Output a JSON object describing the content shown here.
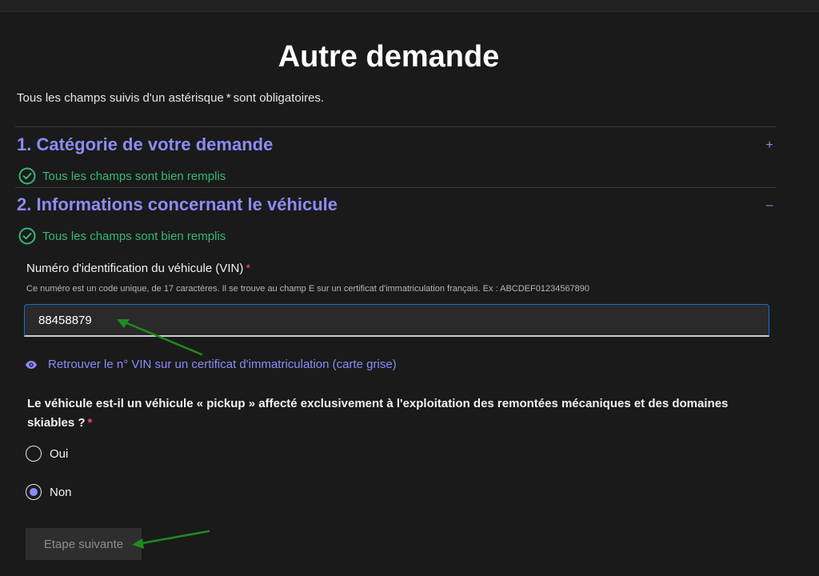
{
  "page": {
    "title": "Autre demande",
    "required_note_pre": "Tous les champs suivis d'un astérisque",
    "required_note_mark": "*",
    "required_note_post": "sont obligatoires."
  },
  "sections": [
    {
      "title": "1. Catégorie de votre demande",
      "toggle": "+",
      "status": "Tous les champs sont bien remplis"
    },
    {
      "title": "2. Informations concernant le véhicule",
      "toggle": "–",
      "status": "Tous les champs sont bien remplis"
    }
  ],
  "vin_field": {
    "label": "Numéro d'identification du véhicule (VIN)",
    "required_mark": "*",
    "hint": "Ce numéro est un code unique, de 17 caractères. Il se trouve au champ E sur un certificat d'immatriculation français. Ex : ABCDEF01234567890",
    "value": "88458879"
  },
  "vin_help_link": {
    "icon": "eye-icon",
    "label": "Retrouver le n° VIN sur un certificat d'immatriculation (carte grise)"
  },
  "pickup_question": {
    "label": "Le véhicule est-il un véhicule « pickup » affecté exclusivement à l'exploitation des remontées mécaniques et des domaines skiables ?",
    "required_mark": "*",
    "options": [
      "Oui",
      "Non"
    ],
    "selected": "Non"
  },
  "next_button": {
    "label": "Etape suivante",
    "disabled": true
  },
  "colors": {
    "accent": "#8b8cf6",
    "success": "#35b873",
    "required": "#f0475c",
    "annotation_arrow": "#1e8c1e"
  }
}
